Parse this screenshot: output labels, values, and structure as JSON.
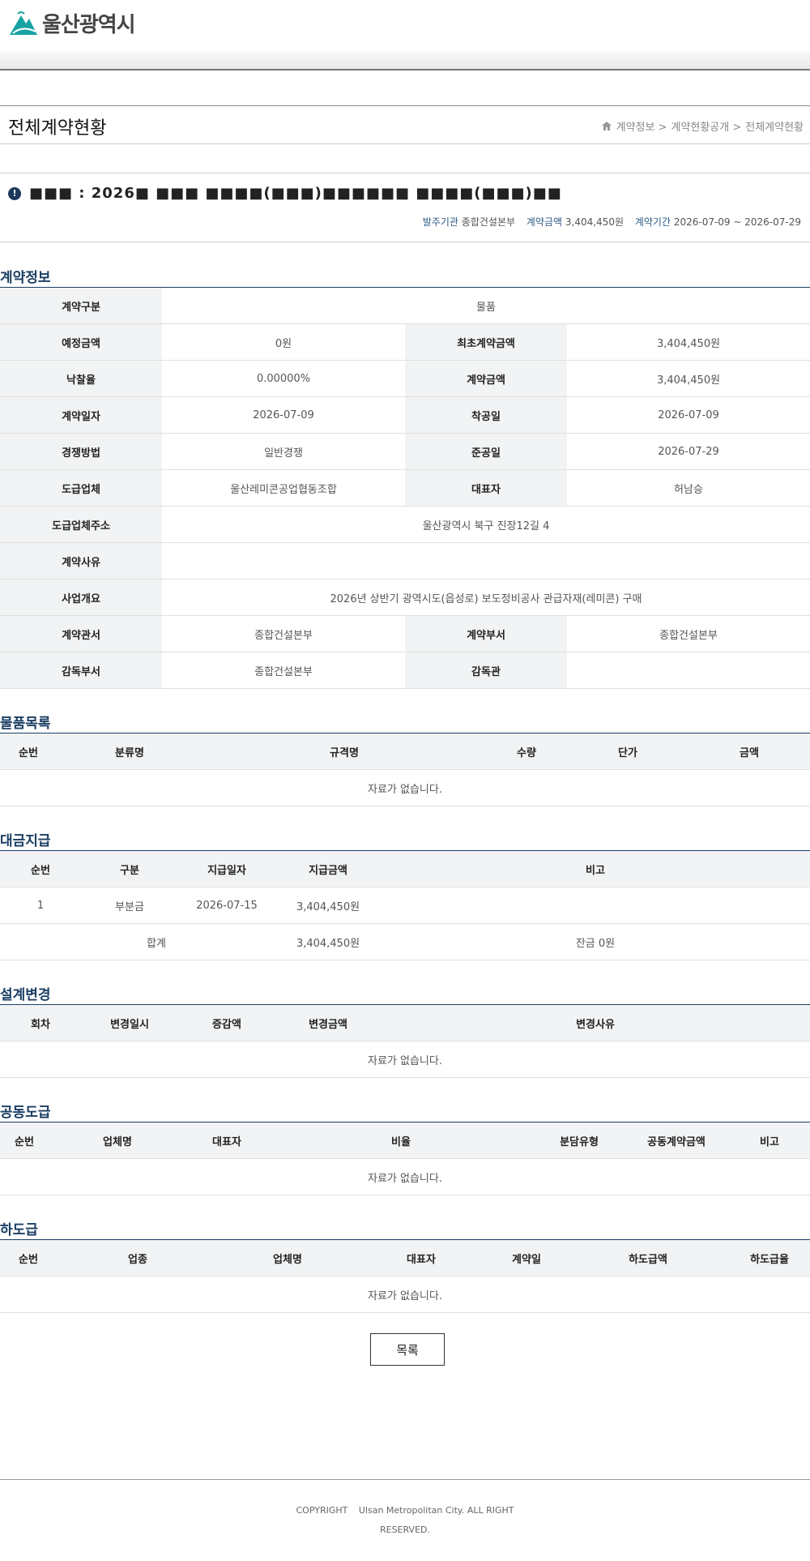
{
  "header": {
    "logo_text": "울산광역시"
  },
  "page": {
    "title": "전체계약현황",
    "breadcrumb": [
      "계약정보 >",
      "계약현황공개 >",
      "전체계약현황"
    ]
  },
  "subject": {
    "text": "■■■ : 2026■ ■■■ ■■■■(■■■)■■■■■■ ■■■■(■■■)■■",
    "meta_labels": [
      "발주기관",
      "계약금액",
      "계약기간"
    ],
    "meta_values": [
      "종합건설본부",
      "3,404,450원",
      "2026-07-09 ~ 2026-07-29"
    ]
  },
  "contract_info": {
    "title": "계약정보",
    "labels": {
      "type": "계약구분",
      "est": "예정금액",
      "initial": "최초계약금액",
      "rate": "낙찰율",
      "amount": "계약금액",
      "date": "계약일자",
      "start": "착공일",
      "method": "경쟁방법",
      "end": "준공일",
      "company": "도급업체",
      "rep": "대표자",
      "addr": "도급업체주소",
      "reason": "계약사유",
      "summary": "사업개요",
      "office": "계약관서",
      "dept": "계약부서",
      "sup_dept": "감독부서",
      "supervisor": "감독관"
    },
    "values": {
      "type": "물품",
      "est": "0원",
      "initial": "3,404,450원",
      "rate": "0.00000%",
      "amount": "3,404,450원",
      "date": "2026-07-09",
      "start": "2026-07-09",
      "method": "일반경쟁",
      "end": "2026-07-29",
      "company": "울산레미콘공업협동조합",
      "rep": "허남승",
      "addr": "울산광역시 북구 진장12길 4",
      "reason": "",
      "summary": "2026년 상반기 광역시도(읍성로) 보도정비공사 관급자재(레미콘) 구매",
      "office": "종합건설본부",
      "dept": "종합건설본부",
      "sup_dept": "종합건설본부",
      "supervisor": ""
    }
  },
  "goods": {
    "title": "물품목록",
    "headers": [
      "순번",
      "분류명",
      "규격명",
      "수량",
      "단가",
      "금액"
    ],
    "empty": "자료가 없습니다."
  },
  "payment": {
    "title": "대금지급",
    "headers": [
      "순번",
      "구분",
      "지급일자",
      "지급금액",
      "비고"
    ],
    "row": {
      "no": "1",
      "type": "부분금",
      "date": "2026-07-15",
      "amount": "3,404,450원",
      "note": ""
    },
    "total": {
      "label": "합계",
      "amount": "3,404,450원",
      "balance": "잔금 0원"
    }
  },
  "design_change": {
    "title": "설계변경",
    "headers": [
      "회차",
      "변경일시",
      "증감액",
      "변경금액",
      "변경사유"
    ],
    "empty": "자료가 없습니다."
  },
  "joint": {
    "title": "공동도급",
    "headers": [
      "순번",
      "업체명",
      "대표자",
      "비율",
      "분담유형",
      "공동계약금액",
      "비고"
    ],
    "empty": "자료가 없습니다."
  },
  "sub": {
    "title": "하도급",
    "headers": [
      "순번",
      "업종",
      "업체명",
      "대표자",
      "계약일",
      "하도급액",
      "하도급율"
    ],
    "empty": "자료가 없습니다."
  },
  "buttons": {
    "list": "목록"
  },
  "footer": {
    "copyright": "COPYRIGHT",
    "line1": "Ulsan Metropolitan City. ALL RIGHT",
    "line2": "RESERVED."
  },
  "colors": {
    "accent": "#1b3e63",
    "logo_teal": "#17a3a3",
    "header_bg": "#f1f3f4"
  }
}
